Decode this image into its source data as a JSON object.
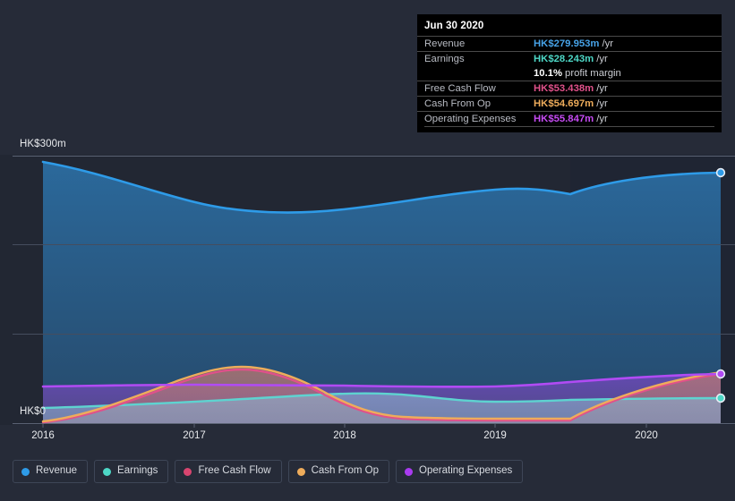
{
  "chart_data": {
    "type": "area",
    "title": "",
    "xlabel": "",
    "ylabel": "",
    "currency": "HK$",
    "unit": "m",
    "period": "/yr",
    "x": [
      "2016",
      "2017",
      "2018",
      "2019",
      "2020"
    ],
    "tick_labels": [
      "2016",
      "2017",
      "2018",
      "2019",
      "2020"
    ],
    "y_axis": {
      "top_label": "HK$300m",
      "bottom_label": "HK$0",
      "ylim": [
        0,
        300
      ],
      "gridlines": [
        0,
        100,
        200,
        300
      ],
      "grid": true
    },
    "legend_position": "bottom",
    "forecast_boundary_x": "2019.6",
    "series": [
      {
        "name": "Revenue",
        "color": "#2E9BE8",
        "values": [
          300,
          265,
          228,
          240,
          232,
          268,
          280
        ],
        "latest": 279.953
      },
      {
        "name": "Earnings",
        "color": "#4DD7C6",
        "values": [
          14,
          17,
          27,
          22,
          17,
          22,
          28.243
        ],
        "latest": 28.243
      },
      {
        "name": "Free Cash Flow",
        "color": "#E0518A",
        "values": [
          1,
          38,
          64,
          22,
          5,
          5,
          53.438
        ],
        "latest": 53.438
      },
      {
        "name": "Cash From Op",
        "color": "#EEAC5B",
        "values": [
          2,
          40,
          66,
          24,
          7,
          7,
          54.697
        ],
        "latest": 54.697
      },
      {
        "name": "Operating Expenses",
        "color": "#B14BF4",
        "values": [
          41,
          41,
          41,
          40,
          41,
          47,
          55.847
        ],
        "latest": 55.847
      }
    ]
  },
  "tooltip": {
    "title": "Jun 30 2020",
    "rows": [
      {
        "label": "Revenue",
        "value": "HK$279.953m",
        "unit": "/yr",
        "color": "#47A3E8"
      },
      {
        "label": "Earnings",
        "value": "HK$28.243m",
        "unit": "/yr",
        "color": "#4DD7C6"
      },
      {
        "label": "",
        "value": "10.1%",
        "unit": "profit margin",
        "color": "#FFFFFF"
      },
      {
        "label": "Free Cash Flow",
        "value": "HK$53.438m",
        "unit": "/yr",
        "color": "#E0518A"
      },
      {
        "label": "Cash From Op",
        "value": "HK$54.697m",
        "unit": "/yr",
        "color": "#EEAC5B"
      },
      {
        "label": "Operating Expenses",
        "value": "HK$55.847m",
        "unit": "/yr",
        "color": "#C74BF4"
      }
    ]
  },
  "legend": {
    "items": [
      {
        "label": "Revenue",
        "color": "#2E9BE8"
      },
      {
        "label": "Earnings",
        "color": "#4DD7C6"
      },
      {
        "label": "Free Cash Flow",
        "color": "#D8456F"
      },
      {
        "label": "Cash From Op",
        "color": "#EEAC5B"
      },
      {
        "label": "Operating Expenses",
        "color": "#A93BF0"
      }
    ]
  },
  "axis": {
    "y_top": "HK$300m",
    "y_bottom": "HK$0",
    "x_ticks": [
      "2016",
      "2017",
      "2018",
      "2019",
      "2020"
    ]
  },
  "colors": {
    "background": "#262B38",
    "plot_background": "#222733",
    "plot_forecast_background": "#202634",
    "gridline": "#545B6B",
    "tooltip_background": "#000000",
    "tooltip_rule": "#4A4A4A"
  }
}
